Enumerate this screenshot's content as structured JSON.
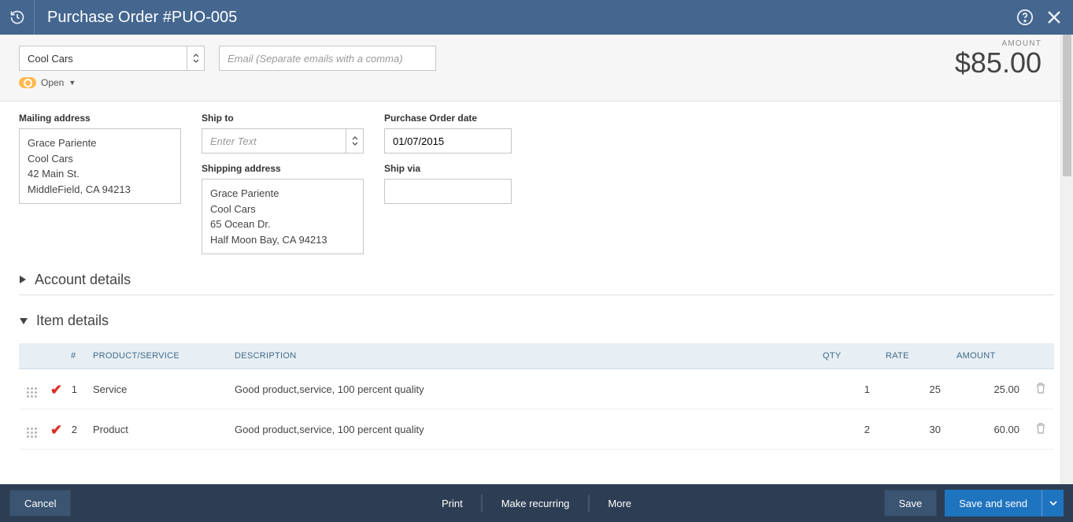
{
  "topbar": {
    "title": "Purchase Order #PUO-005"
  },
  "header": {
    "vendor": "Cool Cars",
    "email_placeholder": "Email (Separate emails with a comma)",
    "amount_label": "AMOUNT",
    "amount_value": "$85.00",
    "status_text": "Open"
  },
  "fields": {
    "mailing_label": "Mailing address",
    "mailing_address": "Grace Pariente\nCool Cars\n42 Main St.\nMiddleField, CA  94213",
    "shipto_label": "Ship to",
    "shipto_placeholder": "Enter Text",
    "shipping_address_label": "Shipping address",
    "shipping_address": "Grace Pariente\nCool Cars\n65 Ocean Dr.\nHalf Moon Bay, CA  94213",
    "po_date_label": "Purchase Order date",
    "po_date": "01/07/2015",
    "shipvia_label": "Ship via",
    "shipvia_value": ""
  },
  "sections": {
    "account_details": "Account details",
    "item_details": "Item details"
  },
  "table": {
    "headers": {
      "num": "#",
      "product": "PRODUCT/SERVICE",
      "desc": "DESCRIPTION",
      "qty": "QTY",
      "rate": "RATE",
      "amount": "AMOUNT"
    },
    "rows": [
      {
        "num": "1",
        "product": "Service",
        "desc": "Good product,service, 100 percent quality",
        "qty": "1",
        "rate": "25",
        "amount": "25.00"
      },
      {
        "num": "2",
        "product": "Product",
        "desc": "Good product,service, 100 percent quality",
        "qty": "2",
        "rate": "30",
        "amount": "60.00"
      }
    ]
  },
  "footer": {
    "cancel": "Cancel",
    "print": "Print",
    "make_recurring": "Make recurring",
    "more": "More",
    "save": "Save",
    "save_and_send": "Save and send"
  }
}
